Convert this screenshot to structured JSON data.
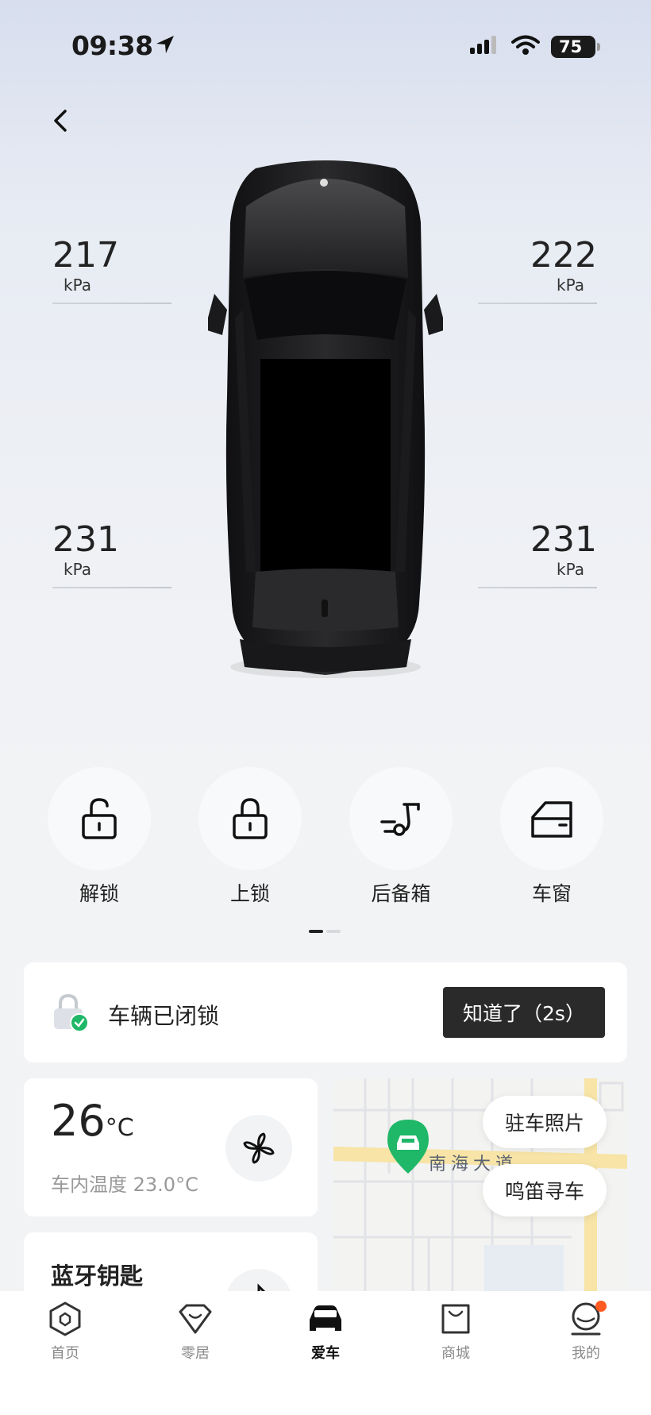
{
  "status_bar": {
    "time": "09:38",
    "battery": "75"
  },
  "tires": {
    "front_left": {
      "value": "217",
      "unit": "kPa"
    },
    "front_right": {
      "value": "222",
      "unit": "kPa"
    },
    "rear_left": {
      "value": "231",
      "unit": "kPa"
    },
    "rear_right": {
      "value": "231",
      "unit": "kPa"
    }
  },
  "controls": [
    {
      "label": "解锁",
      "icon": "unlock-icon"
    },
    {
      "label": "上锁",
      "icon": "lock-icon"
    },
    {
      "label": "后备箱",
      "icon": "trunk-icon"
    },
    {
      "label": "车窗",
      "icon": "window-icon"
    }
  ],
  "notice": {
    "text": "车辆已闭锁",
    "button": "知道了（2s）"
  },
  "climate": {
    "temp": "26",
    "unit": "°C",
    "inside": "车内温度 23.0°C"
  },
  "bluetooth": {
    "title": "蓝牙钥匙"
  },
  "map": {
    "road": "南海大道",
    "parking_photo": "驻车照片",
    "honk_find": "鸣笛寻车"
  },
  "tabs": [
    {
      "label": "首页",
      "icon": "home-hexagon-icon"
    },
    {
      "label": "零居",
      "icon": "heart-shape-icon"
    },
    {
      "label": "爱车",
      "icon": "car-icon"
    },
    {
      "label": "商城",
      "icon": "shopping-bag-icon"
    },
    {
      "label": "我的",
      "icon": "profile-icon"
    }
  ],
  "colors": {
    "accent_green": "#1fb768",
    "badge_orange": "#ff5a1f",
    "dark_button": "#2a2a2a"
  }
}
